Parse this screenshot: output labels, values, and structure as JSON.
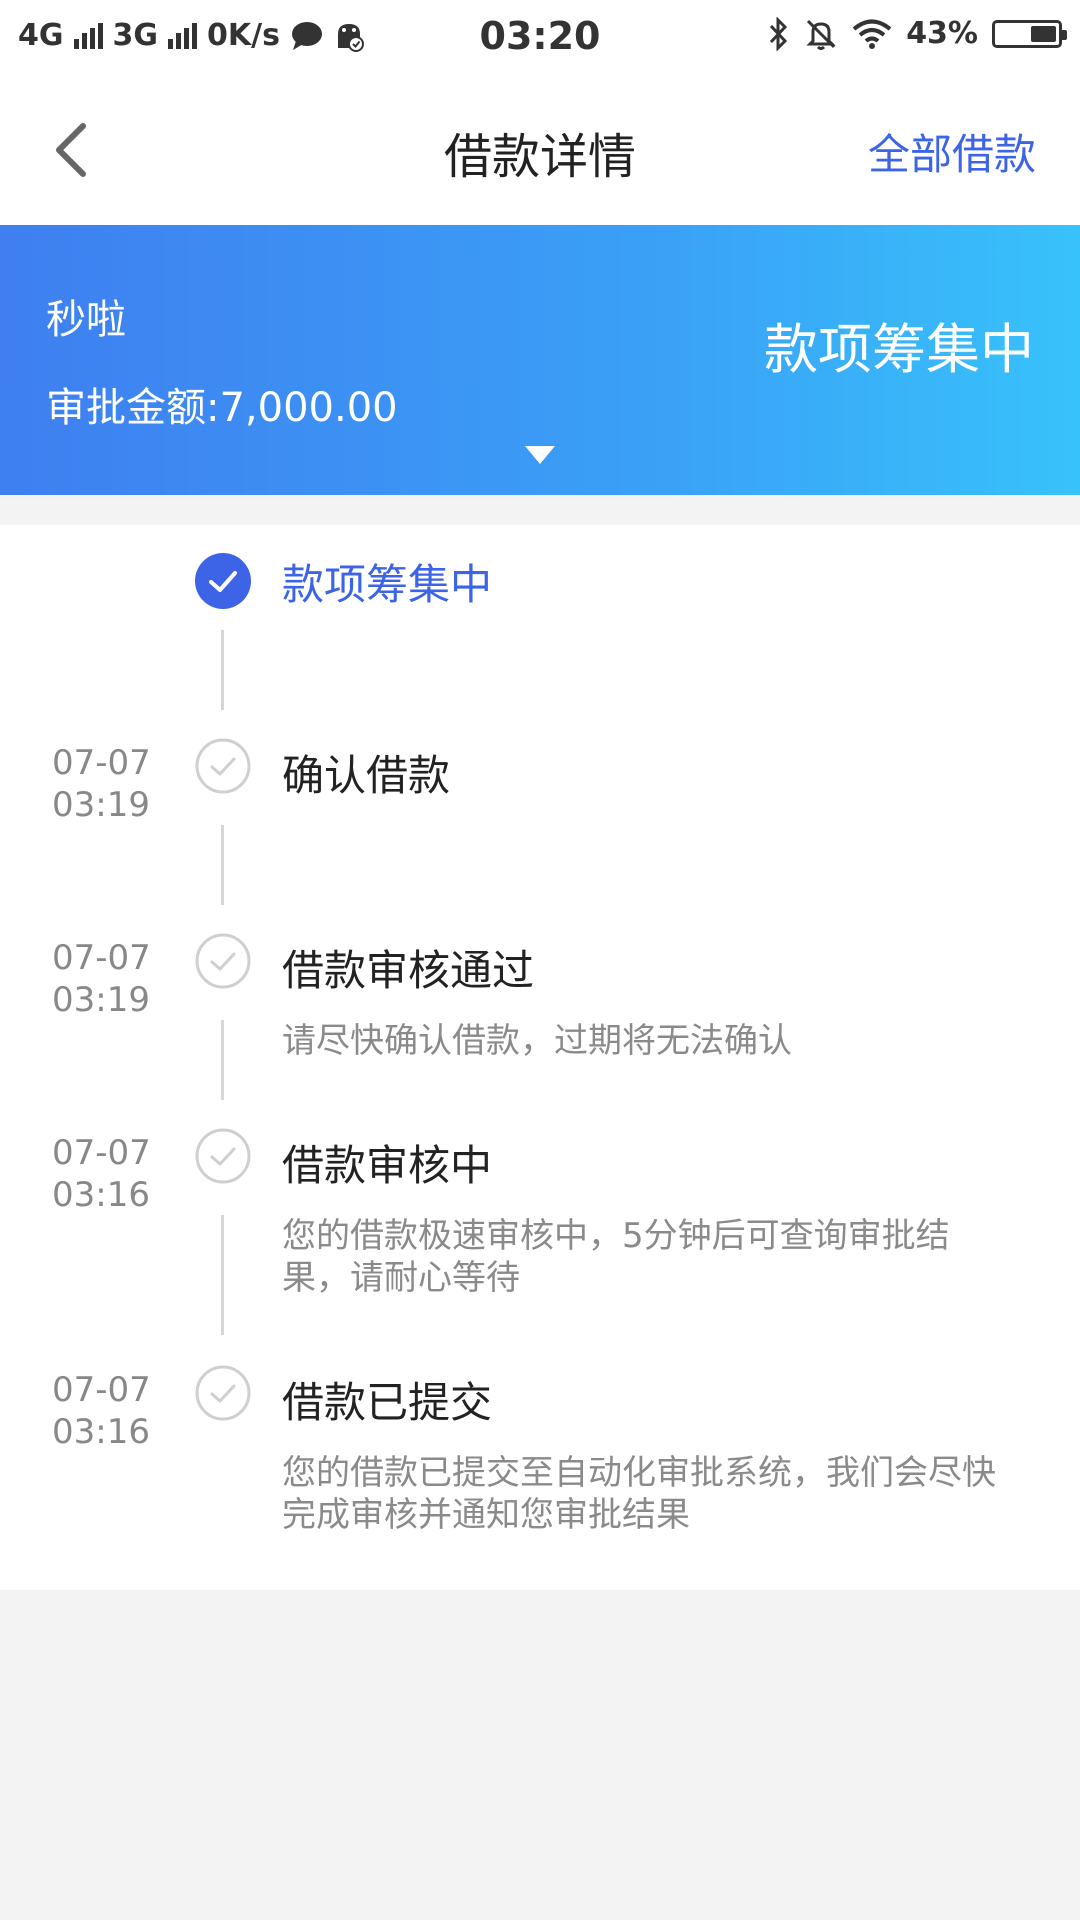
{
  "status_bar": {
    "network1": "4G",
    "network2": "3G",
    "speed": "0K/s",
    "time": "03:20",
    "battery": "43%",
    "battery_level": 0.43
  },
  "header": {
    "title": "借款详情",
    "all_loans_label": "全部借款"
  },
  "banner": {
    "product_name": "秒啦",
    "approved_amount": "审批金额:7,000.00",
    "status": "款项筹集中"
  },
  "timeline": {
    "steps": [
      {
        "date": "",
        "time": "",
        "title": "款项筹集中",
        "desc": "",
        "active": true
      },
      {
        "date": "07-07",
        "time": "03:19",
        "title": "确认借款",
        "desc": "",
        "active": false
      },
      {
        "date": "07-07",
        "time": "03:19",
        "title": "借款审核通过",
        "desc": "请尽快确认借款，过期将无法确认",
        "active": false
      },
      {
        "date": "07-07",
        "time": "03:16",
        "title": "借款审核中",
        "desc": "您的借款极速审核中，5分钟后可查询审批结果，请耐心等待",
        "active": false
      },
      {
        "date": "07-07",
        "time": "03:16",
        "title": "借款已提交",
        "desc": "您的借款已提交至自动化审批系统，我们会尽快完成审核并通知您审批结果",
        "active": false
      }
    ]
  },
  "colors": {
    "accent": "#3d64e6",
    "banner_start": "#3f7ff0",
    "banner_end": "#38c2fb"
  }
}
